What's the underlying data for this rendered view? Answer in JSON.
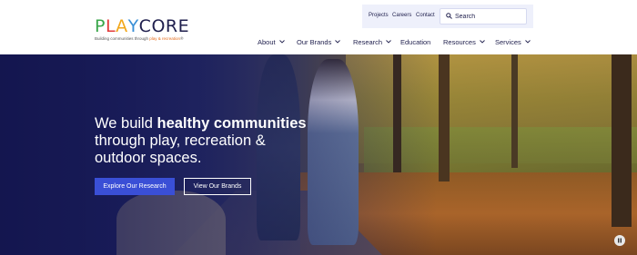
{
  "logo": {
    "letters": [
      {
        "ch": "P",
        "color": "#3aa64a"
      },
      {
        "ch": "L",
        "color": "#e23b3b"
      },
      {
        "ch": "A",
        "color": "#f2a71b"
      },
      {
        "ch": "Y",
        "color": "#3a8fd6"
      },
      {
        "ch": "C",
        "color": "#1f1f4d"
      },
      {
        "ch": "O",
        "color": "#1f1f4d"
      },
      {
        "ch": "R",
        "color": "#1f1f4d"
      },
      {
        "ch": "E",
        "color": "#1f1f4d"
      }
    ],
    "tagline_start": "Building communities through ",
    "tagline_highlight": "play & recreation",
    "tagline_mark": "®"
  },
  "utility": {
    "projects": "Projects",
    "careers": "Careers",
    "contact": "Contact",
    "search_placeholder": "Search"
  },
  "nav": {
    "about": "About",
    "brands": "Our Brands",
    "research": "Research",
    "education": "Education",
    "resources": "Resources",
    "services": "Services"
  },
  "hero": {
    "line1_pre": "We build ",
    "line1_bold": "healthy communities",
    "line2": "through play, recreation &",
    "line3": "outdoor spaces.",
    "primary_cta": "Explore Our Research",
    "secondary_cta": "View Our Brands"
  },
  "colors": {
    "navy": "#1f1f4d",
    "primary_button": "#3a4fd6",
    "utility_bar": "#eef0fb"
  }
}
